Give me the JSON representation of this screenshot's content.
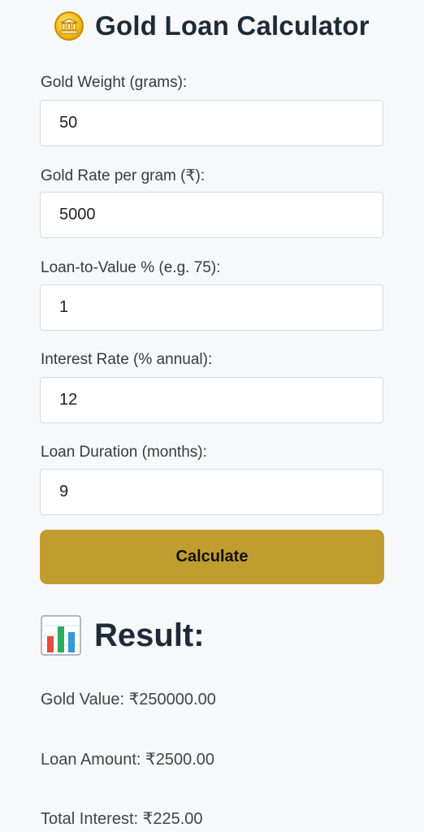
{
  "header": {
    "title": "Gold Loan Calculator",
    "icon": "gold-coin-icon"
  },
  "form": {
    "gold_weight": {
      "label": "Gold Weight (grams):",
      "value": "50"
    },
    "gold_rate": {
      "label": "Gold Rate per gram (₹):",
      "value": "5000"
    },
    "ltv": {
      "label": "Loan-to-Value % (e.g. 75):",
      "value": "1"
    },
    "interest_rate": {
      "label": "Interest Rate (% annual):",
      "value": "12"
    },
    "duration": {
      "label": "Loan Duration (months):",
      "value": "9"
    },
    "calculate_label": "Calculate"
  },
  "result": {
    "title": "Result:",
    "icon": "bar-chart-icon",
    "gold_value": "Gold Value: ₹250000.00",
    "loan_amount": "Loan Amount: ₹2500.00",
    "total_interest": "Total Interest: ₹225.00"
  },
  "colors": {
    "background": "#f7f8fa",
    "button": "#c19c2f",
    "title": "#1e2a38"
  }
}
